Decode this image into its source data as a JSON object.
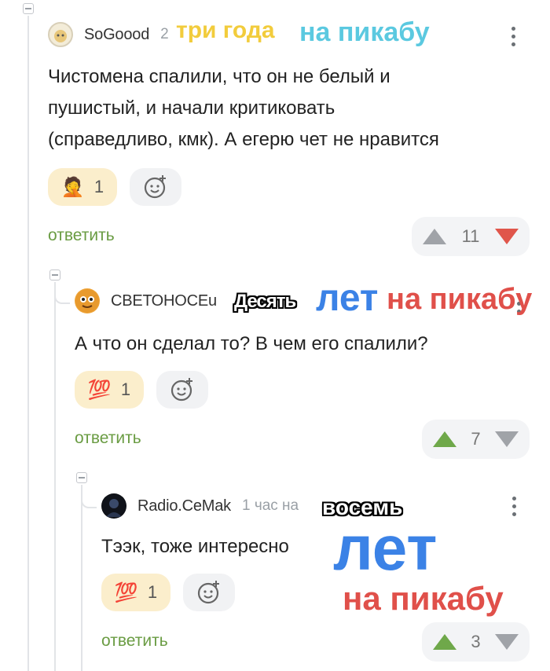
{
  "comments": [
    {
      "author": "SoGoood",
      "meta": "2",
      "text_lines": [
        "Чистомена спалили, что он не белый и",
        "пушистый, и начали критиковать",
        "(справедливо, кмк). А егерю чет не нравится"
      ],
      "reaction_count": "1",
      "reply_label": "ответить",
      "score": "11"
    },
    {
      "author": "СВЕТОНОСЕu",
      "meta": "",
      "text_lines": [
        "А что он сделал то? В чем его спалили?"
      ],
      "reaction_emoji": "💯",
      "reaction_count": "1",
      "reply_label": "ответить",
      "score": "7"
    },
    {
      "author": "Radio.CeMak",
      "meta": "1 час на",
      "text_lines": [
        "Тээк, тоже интересно"
      ],
      "reaction_emoji": "💯",
      "reaction_count": "1",
      "reply_label": "ответить",
      "score": "3"
    }
  ],
  "overlays": {
    "tri_goda": "три года",
    "na_pikabu_1": "на пикабу",
    "desyat": "Десять",
    "let_1": "лет",
    "na_pikabu_2": "на пикабу",
    "vosem": "восемь",
    "let_2": "лет",
    "na_pikabu_3": "на пикабу"
  },
  "colors": {
    "reply_green": "#6a9c43",
    "vote_up_green": "#6fa84a",
    "vote_down_red": "#e0564b",
    "overlay_yellow": "#f2cc3c",
    "overlay_cyan": "#5bc9e0",
    "overlay_blue": "#3b82e6",
    "overlay_red": "#e0504a"
  }
}
